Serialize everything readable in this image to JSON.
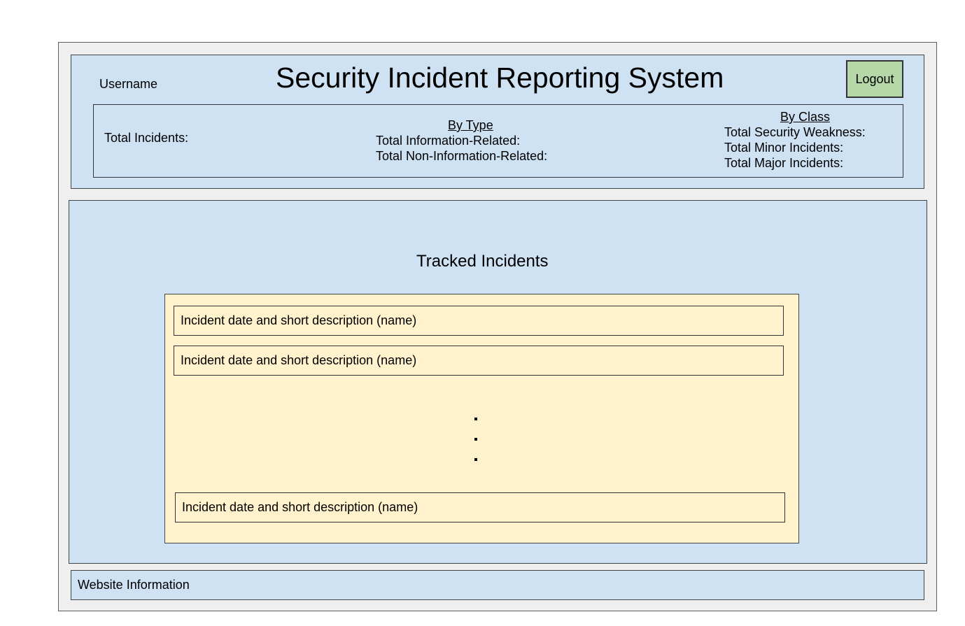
{
  "header": {
    "username": "Username",
    "title": "Security Incident Reporting System",
    "logout_label": "Logout"
  },
  "stats": {
    "total_incidents_label": "Total Incidents:",
    "by_type": {
      "heading": "By Type",
      "information_related": "Total Information-Related:",
      "non_information_related": "Total Non-Information-Related:"
    },
    "by_class": {
      "heading": "By Class",
      "security_weakness": "Total Security Weakness:",
      "minor_incidents": "Total Minor Incidents:",
      "major_incidents": "Total Major Incidents:"
    }
  },
  "main": {
    "title": "Tracked Incidents",
    "incidents": [
      "Incident date and short description (name)",
      "Incident date and short description (name)",
      "Incident date and short description (name)"
    ]
  },
  "footer": {
    "text": "Website Information"
  },
  "colors": {
    "panel_blue": "#cfe2f3",
    "list_yellow": "#fff2cc",
    "logout_green": "#b6d7a8",
    "frame_gray": "#efefef"
  }
}
